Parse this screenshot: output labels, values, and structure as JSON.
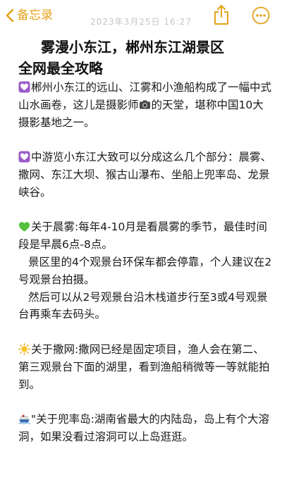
{
  "nav": {
    "back_label": "备忘录",
    "timestamp": "2023年3月25日 16:27",
    "accent_color": "#E3A21A",
    "icons": [
      "chevron-left-icon",
      "share-icon",
      "more-icon"
    ]
  },
  "note": {
    "title_line1": "雾漫小东江，郴州东江湖景区",
    "title_line2": "全网最全攻略",
    "p1": "郴州小东江的远山、江雾和小渔船构成了一幅中式山水画卷，这儿是摄影师",
    "p1b": "的天堂，堪称中国10大摄影基地之一。",
    "p2": "中游览小东江大致可以分成这么几个部分：晨雾、撒网、东江大坝、猴古山瀑布、坐船上兜率岛、龙景峡谷。",
    "p3": "关于晨雾:每年4-10月是看晨雾的季节，最佳时间段是早晨6点-8点。",
    "p4": "景区里的4个观景台环保车都会停靠，个人建议在2号观景台拍摄。",
    "p5": "然后可以从2号观景台沿木栈道步行至3或4号观景台再乘车去码头。",
    "p6": "关于撒网:撒网已经是固定项目，渔人会在第二、第三观景台下面的湖里，看到渔船稍微等一等就能拍到。",
    "p7": "\"关于兜率岛:湖南省最大的内陆岛，岛上有个大溶洞，如果没看过溶洞可以上岛逛逛。"
  }
}
